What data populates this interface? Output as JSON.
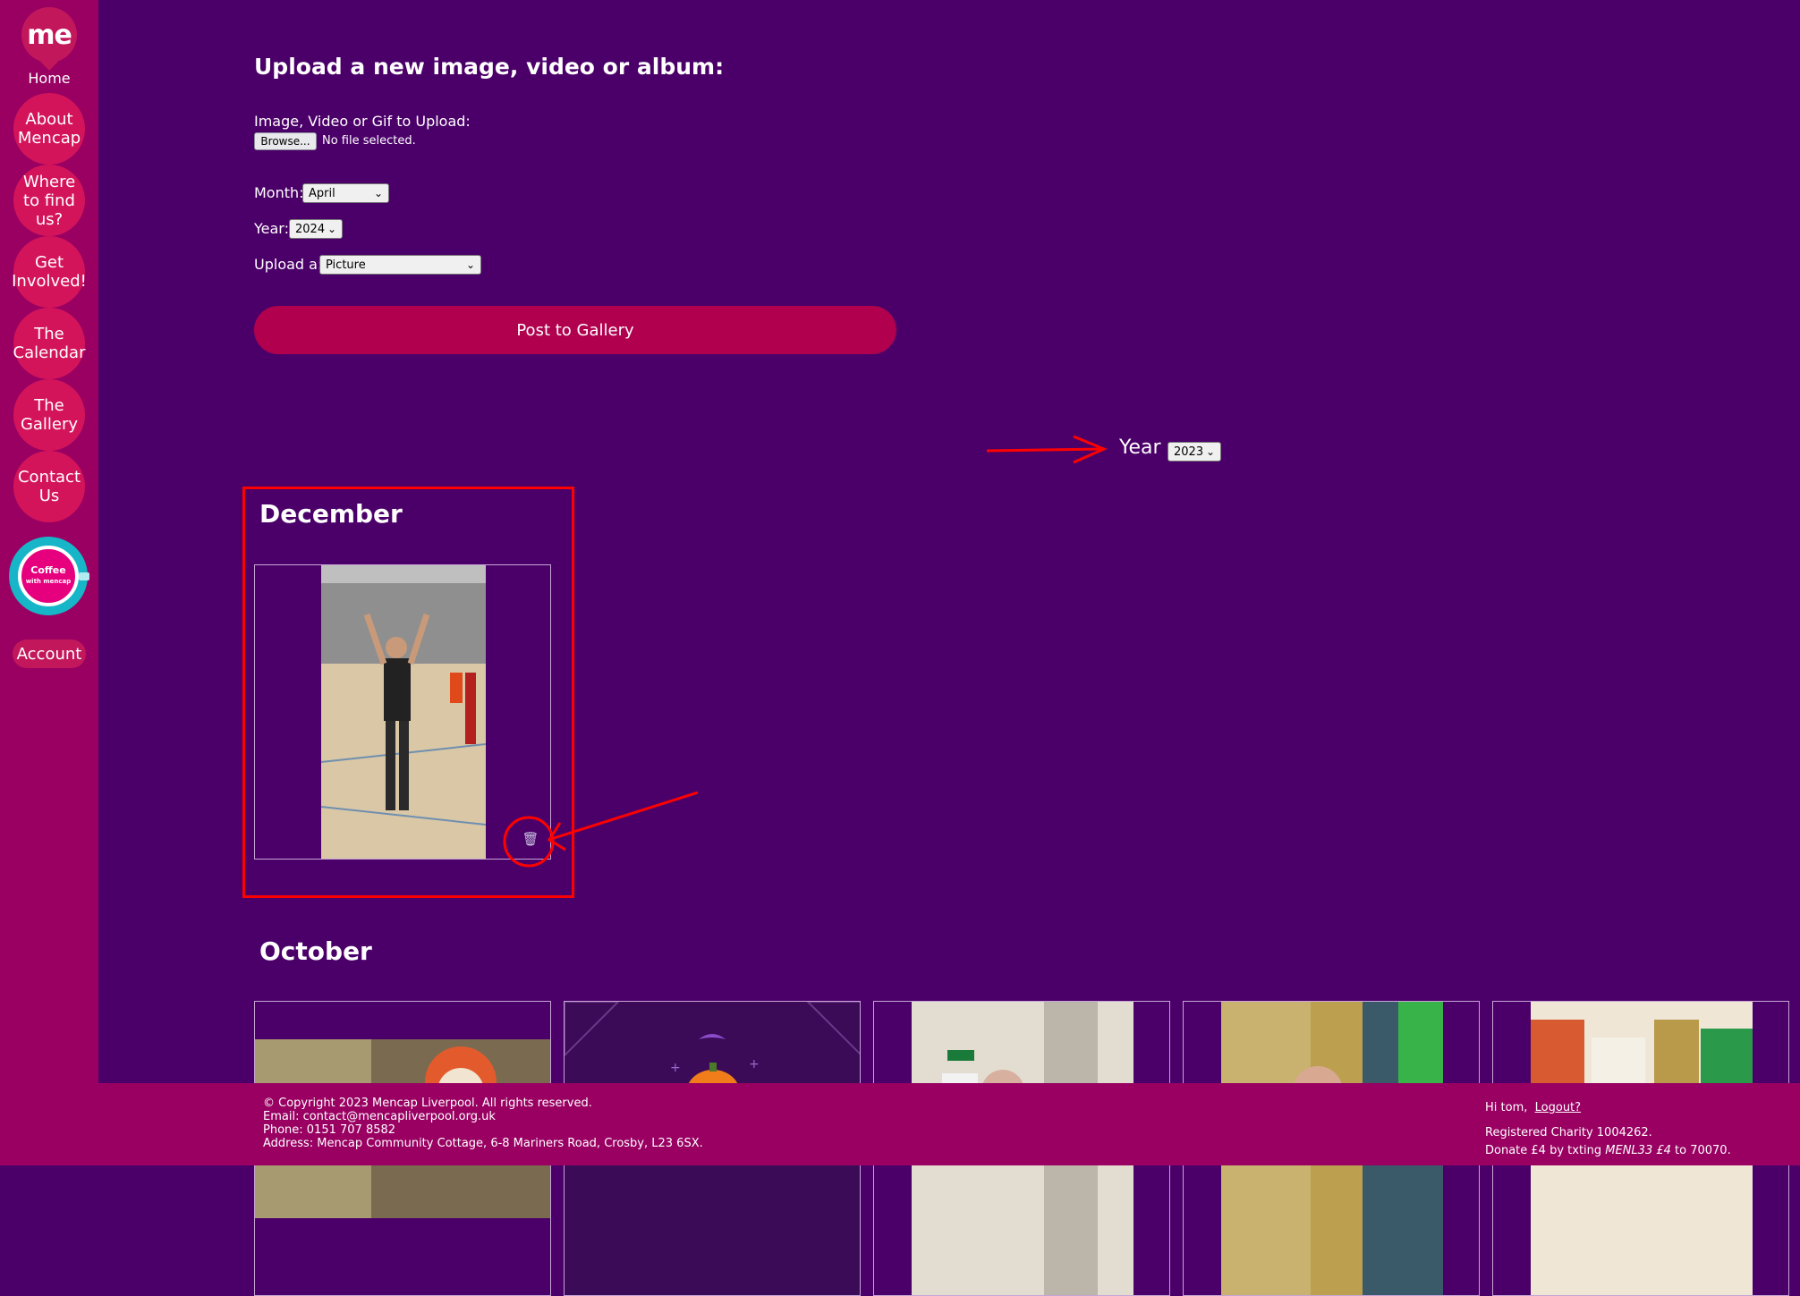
{
  "sidebar": {
    "logo": "me",
    "home_label": "Home",
    "items": [
      {
        "label": "About Mencap"
      },
      {
        "label": "Where to find us?"
      },
      {
        "label": "Get Involved!"
      },
      {
        "label": "The Calendar"
      },
      {
        "label": "The Gallery"
      },
      {
        "label": "Contact Us"
      }
    ],
    "coffee_label_1": "Coffee",
    "coffee_label_2": "with mencap",
    "account_label": "Account"
  },
  "upload": {
    "title": "Upload a new image, video or album:",
    "file_label": "Image, Video or Gif to Upload:",
    "browse_label": "Browse...",
    "no_file_text": "No file selected.",
    "month_label": "Month:",
    "month_value": "April",
    "year_label": "Year:",
    "year_value": "2024",
    "type_label": "Upload a:",
    "type_value": "Picture",
    "post_button": "Post to Gallery"
  },
  "filter": {
    "year_label": "Year",
    "year_value": "2023"
  },
  "gallery": {
    "months": [
      {
        "name": "December",
        "photos": 1
      },
      {
        "name": "October",
        "photos": 5
      }
    ]
  },
  "footer": {
    "copyright": "© Copyright 2023 Mencap Liverpool. All rights reserved.",
    "email": "Email:  contact@mencapliverpool.org.uk",
    "phone": "Phone:  0151 707 8582",
    "address": "Address:  Mencap Community Cottage, 6-8 Mariners Road, Crosby, L23 6SX.",
    "greeting": "Hi tom,",
    "logout": "Logout?",
    "charity": "Registered Charity 1004262.",
    "donate_prefix": "Donate £4 by txting ",
    "donate_code": "MENL33 £4",
    "donate_suffix": " to 70070."
  },
  "colors": {
    "background": "#4b0069",
    "sidebar": "#990062",
    "nav_circle": "#d4145a",
    "post_button": "#b0004e",
    "annotation": "#ff0000"
  }
}
